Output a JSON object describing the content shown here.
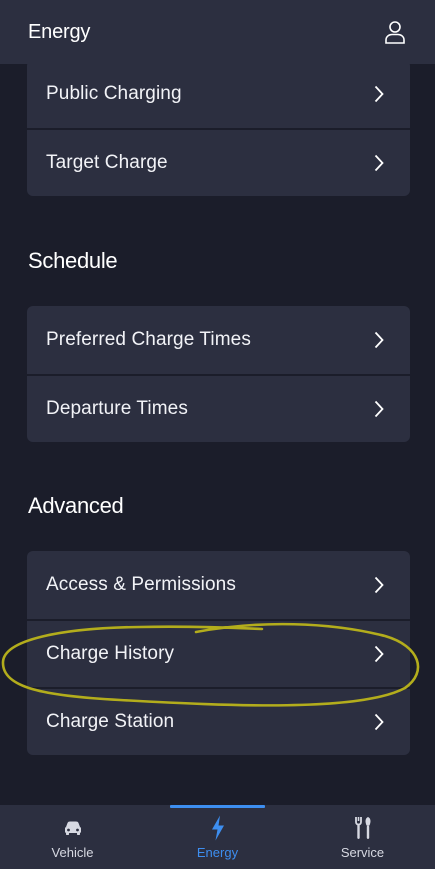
{
  "header": {
    "title": "Energy",
    "profile_icon": "user-icon"
  },
  "groups": [
    {
      "items": [
        {
          "label": "Public Charging"
        },
        {
          "label": "Target Charge"
        }
      ]
    }
  ],
  "sections": [
    {
      "title": "Schedule",
      "items": [
        {
          "label": "Preferred Charge Times"
        },
        {
          "label": "Departure Times"
        }
      ]
    },
    {
      "title": "Advanced",
      "items": [
        {
          "label": "Access & Permissions"
        },
        {
          "label": "Charge History",
          "highlighted": true
        },
        {
          "label": "Charge Station"
        }
      ]
    }
  ],
  "tabbar": {
    "tabs": [
      {
        "label": "Vehicle",
        "icon": "car-icon",
        "active": false
      },
      {
        "label": "Energy",
        "icon": "lightning-bolt-icon",
        "active": true
      },
      {
        "label": "Service",
        "icon": "tools-icon",
        "active": false
      }
    ]
  },
  "colors": {
    "background": "#1b1d2a",
    "card": "#2c2f40",
    "accent": "#3d8ef0",
    "annotation": "#b3ad1c"
  }
}
